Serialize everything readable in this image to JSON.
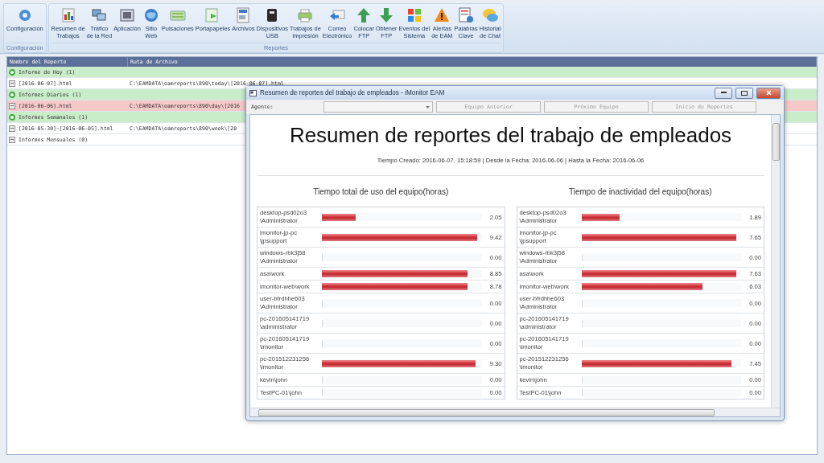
{
  "ribbon": {
    "groups": [
      {
        "label": "Configuración",
        "buttons": [
          "Configuración"
        ]
      },
      {
        "label": "Reportes",
        "buttons": [
          "Resumen de\nTrabajos",
          "Tráfico\nde la Red",
          "Aplicación",
          "Sitio\nWeb",
          "Pulsaciones",
          "Portapapeles",
          "Archivos",
          "Dispositivos\nUSB",
          "Trabajos de\nImpresión",
          "Correo\nElectrónico",
          "Colocar\nFTP",
          "Obtener\nFTP",
          "Eventos del\nSistema",
          "Alertas\nde EAM",
          "Palabras\nClave",
          "Historial\nde Chat"
        ]
      }
    ]
  },
  "report_list": {
    "columns": [
      "Nombre del Reporte",
      "Ruta de Archivo"
    ],
    "rows": [
      {
        "kind": "group",
        "name": "Informe de Hoy (1)"
      },
      {
        "kind": "file",
        "name": "[2016-06-07].html",
        "path": "C:\\EAMDATA\\eamreports\\890\\today\\[2016-06-07].html",
        "selected": false
      },
      {
        "kind": "group",
        "name": "Informes Diarios (1)"
      },
      {
        "kind": "file",
        "name": "[2016-06-06].html",
        "path": "C:\\EAMDATA\\eamreports\\890\\day\\[2016",
        "selected": true
      },
      {
        "kind": "group",
        "name": "Informes Semanales (1)"
      },
      {
        "kind": "file",
        "name": "[2016-05-30]~[2016-06-05].html",
        "path": "C:\\EAMDATA\\eamreports\\890\\week\\[20",
        "selected": false
      },
      {
        "kind": "file",
        "name": "Informes Mensuales (0)",
        "selected": false
      }
    ]
  },
  "dialog": {
    "title": "Resumen de reportes del trabajo de empleados - iMonitor EAM",
    "agent_label": "Agente:",
    "buttons": [
      {
        "label": "Equipo Anterior",
        "disabled": true
      },
      {
        "label": "Próximo Equipo",
        "disabled": true
      },
      {
        "label": "Inicio de Reportes",
        "disabled": true
      }
    ],
    "report": {
      "heading": "Resumen de reportes del trabajo de empleados",
      "meta": "Tiempo Creado: 2016-06-07, 15:18:59 | Desde la Fecha: 2016-06-06 | Hasta la Fecha: 2016-06-06",
      "sections": [
        {
          "title": "Tiempo total de uso del equipo(horas)",
          "rows": [
            {
              "name": "desktop-psd02o3\\Administrator",
              "level": 0.21,
              "reading": "2.05"
            },
            {
              "name": "imonitor-jp-pc\\jpsupport",
              "level": 0.97,
              "reading": "9.42"
            },
            {
              "name": "windows-rbk3j58\\Administrator",
              "level": 0,
              "reading": "0.00"
            },
            {
              "name": "asa\\work",
              "level": 0.91,
              "reading": "8.85"
            },
            {
              "name": "imonitor-web\\work",
              "level": 0.91,
              "reading": "8.78"
            },
            {
              "name": "user-bfrdhhe603\\Administrator",
              "level": 0,
              "reading": "0.00"
            },
            {
              "name": "pc-201605141719\\administrator",
              "level": 0,
              "reading": "0.00"
            },
            {
              "name": "pc-201605141719\\imonitor",
              "level": 0,
              "reading": "0.00"
            },
            {
              "name": "pc-201512231256\\imonitor",
              "level": 0.96,
              "reading": "9.30"
            },
            {
              "name": "kevin\\john",
              "level": 0,
              "reading": "0.00"
            },
            {
              "name": "TestPC-01\\john",
              "level": 0,
              "reading": "0.00"
            }
          ]
        },
        {
          "title": "Tiempo de inactividad del equipo(horas)",
          "rows": [
            {
              "name": "desktop-psd02o3\\Administrator",
              "level": 0.24,
              "reading": "1.89"
            },
            {
              "name": "imonitor-jp-pc\\jpsupport",
              "level": 0.97,
              "reading": "7.65"
            },
            {
              "name": "windows-rbk3j58\\Administrator",
              "level": 0,
              "reading": "0.00"
            },
            {
              "name": "asa\\work",
              "level": 0.97,
              "reading": "7.63"
            },
            {
              "name": "imonitor-web\\work",
              "level": 0.76,
              "reading": "6.03"
            },
            {
              "name": "user-bfrdhhe603\\Administrator",
              "level": 0,
              "reading": "0.00"
            },
            {
              "name": "pc-201605141719\\administrator",
              "level": 0,
              "reading": "0.00"
            },
            {
              "name": "pc-201605141719\\imonitor",
              "level": 0,
              "reading": "0.00"
            },
            {
              "name": "pc-201512231256\\imonitor",
              "level": 0.94,
              "reading": "7.45"
            },
            {
              "name": "kevin\\john",
              "level": 0,
              "reading": "0.00"
            },
            {
              "name": "TestPC-01\\john",
              "level": 0,
              "reading": "0.00"
            }
          ]
        }
      ]
    }
  }
}
